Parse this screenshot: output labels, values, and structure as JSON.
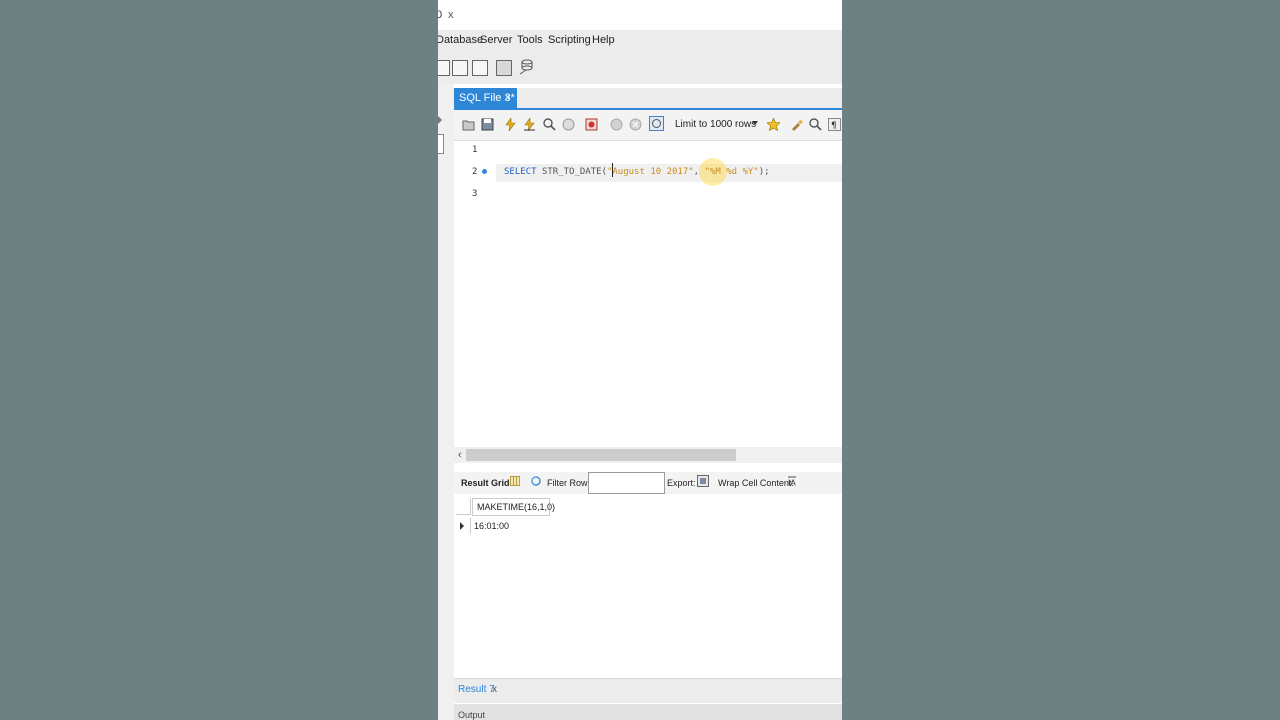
{
  "title": {
    "partial": "0",
    "close": "x"
  },
  "menu": {
    "items": [
      "Database",
      "Server",
      "Tools",
      "Scripting",
      "Help"
    ]
  },
  "tab": {
    "label": "SQL File 3*",
    "close": "x"
  },
  "editor_toolbar": {
    "limit_label": "Limit to 1000 rows"
  },
  "editor": {
    "line_numbers": [
      "1",
      "2",
      "3"
    ],
    "code": {
      "keyword": "SELECT",
      "function": "STR_TO_DATE(",
      "arg1": "\"August 10 2017\"",
      "sep": ", ",
      "arg2": "\"%M %d %Y\"",
      "tail": ");"
    }
  },
  "result_toolbar": {
    "result_grid": "Result Grid",
    "filter_rows": "Filter Rows:",
    "export": "Export:",
    "wrap": "Wrap Cell Content:"
  },
  "result_grid": {
    "columns": [
      "MAKETIME(16,1,0)"
    ],
    "rows": [
      [
        "16:01:00"
      ]
    ]
  },
  "bottom_tabs": {
    "result": "Result 7",
    "close": "x",
    "output": "Output"
  },
  "colors": {
    "accent": "#2e86d6",
    "keyword": "#1f5fc4",
    "string": "#c88d1a"
  }
}
